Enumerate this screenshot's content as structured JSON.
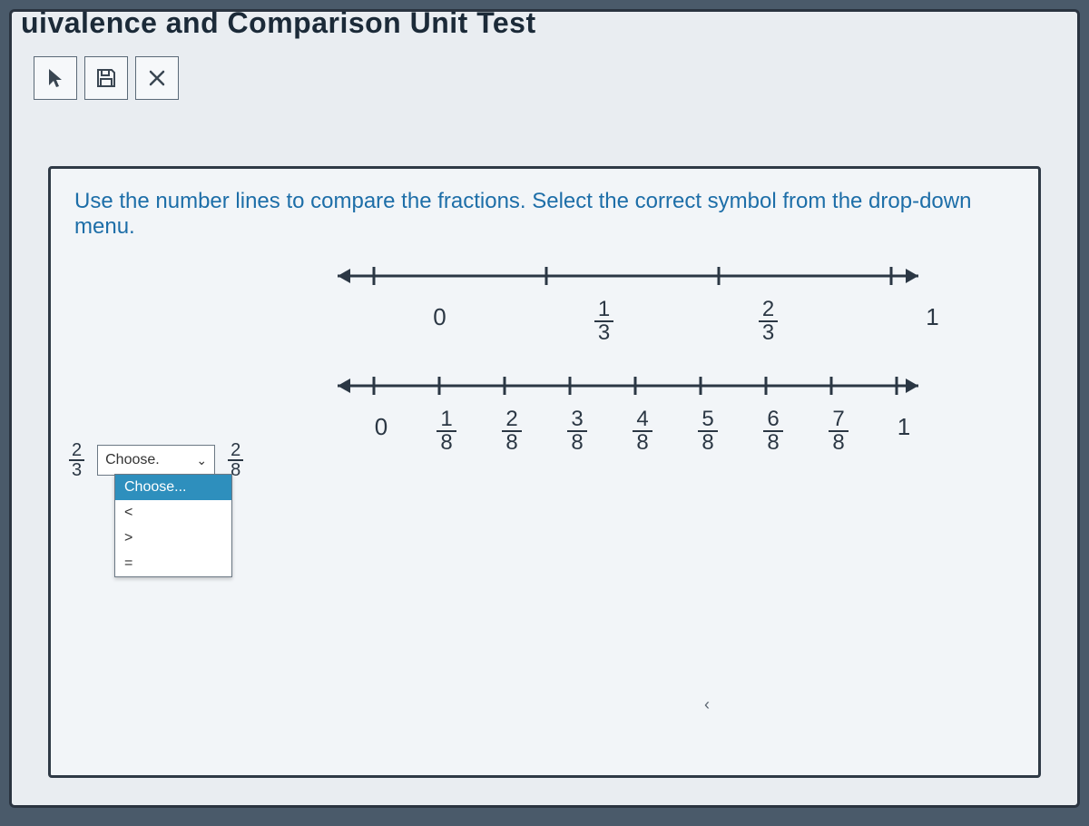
{
  "header": {
    "title": "uivalence and Comparison Unit Test"
  },
  "toolbar": {
    "pointer": "pointer-icon",
    "save": "save-icon",
    "close": "close-icon"
  },
  "prompt": "Use the number lines to compare the fractions. Select the correct symbol from the drop-down menu.",
  "line1": {
    "labels": [
      "0",
      "1/3",
      "2/3",
      "1"
    ]
  },
  "line2": {
    "labels": [
      "0",
      "1/8",
      "2/8",
      "3/8",
      "4/8",
      "5/8",
      "6/8",
      "7/8",
      "1"
    ]
  },
  "answer": {
    "left": {
      "n": "2",
      "d": "3"
    },
    "selected": "Choose.",
    "right": {
      "n": "2",
      "d": "8"
    }
  },
  "dropdown": {
    "options": [
      "Choose...",
      "<",
      ">",
      "="
    ]
  },
  "chevron": "⌄"
}
